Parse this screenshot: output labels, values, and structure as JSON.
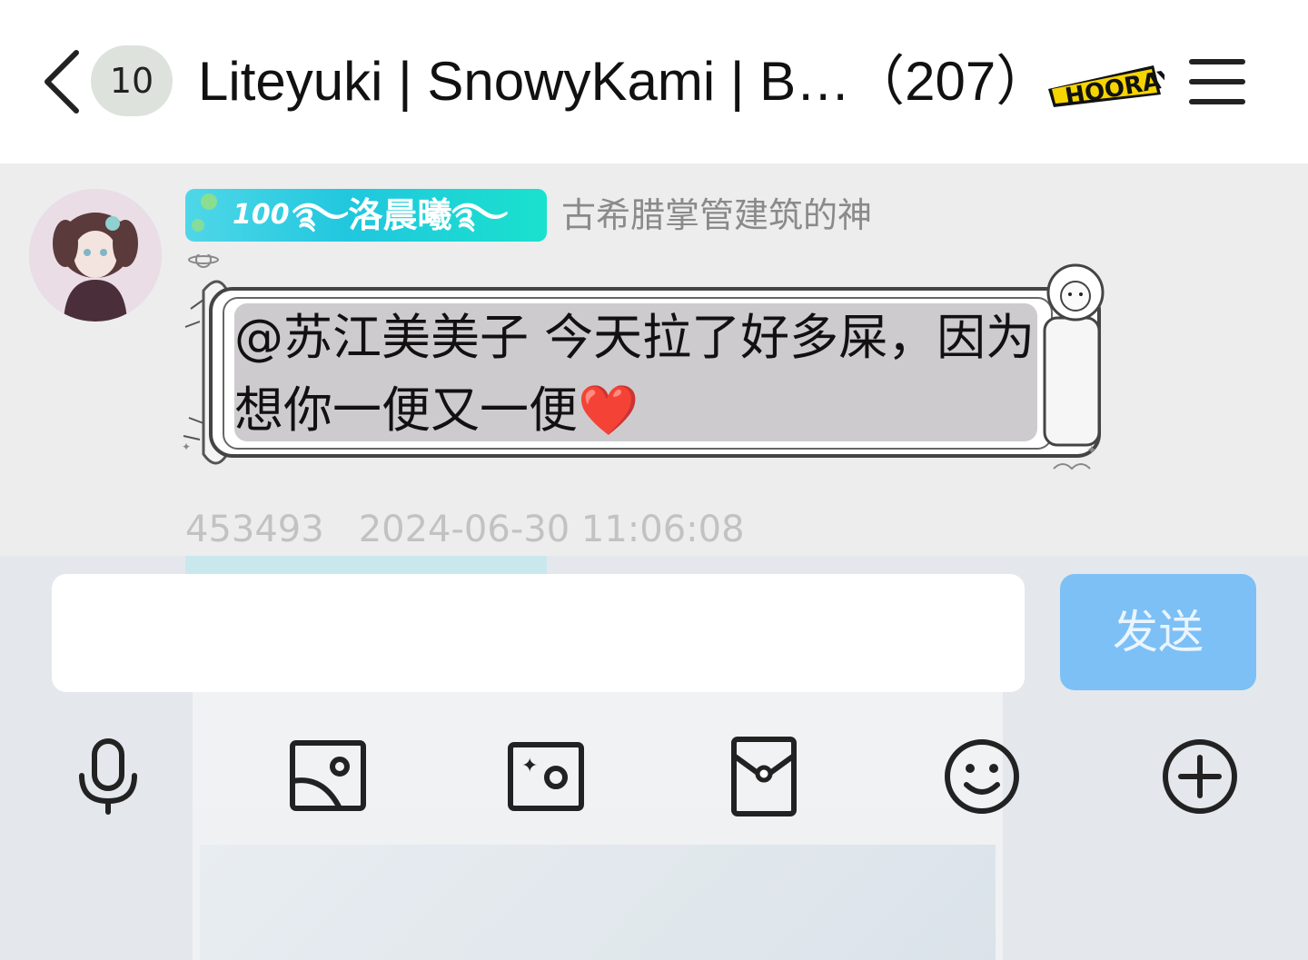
{
  "header": {
    "unread_count": "10",
    "title": "Liteyuki | SnowyKami | B…（207）",
    "title_badge_text": "HOORAY"
  },
  "message": {
    "level": "100",
    "nickname": "࿐洛晨曦࿐",
    "member_title": "古希腊掌管建筑的神",
    "text": "@苏江美美子 今天拉了好多屎，因为想你一便又一便❤️",
    "id": "453493",
    "timestamp": "2024-06-30 11:06:08"
  },
  "input": {
    "placeholder": "",
    "value": "",
    "send_label": "发送"
  },
  "toolbar": {
    "items": [
      "microphone-icon",
      "image-icon",
      "camera-icon",
      "red-packet-icon",
      "emoji-icon",
      "plus-icon"
    ]
  },
  "colors": {
    "header_bg": "#ffffff",
    "chat_bg": "#ededed",
    "bubble_fill": "#cecbce",
    "level_badge": "#21c7de",
    "send_button": "#7cc0f6",
    "meta_text": "#c2c2c2"
  }
}
